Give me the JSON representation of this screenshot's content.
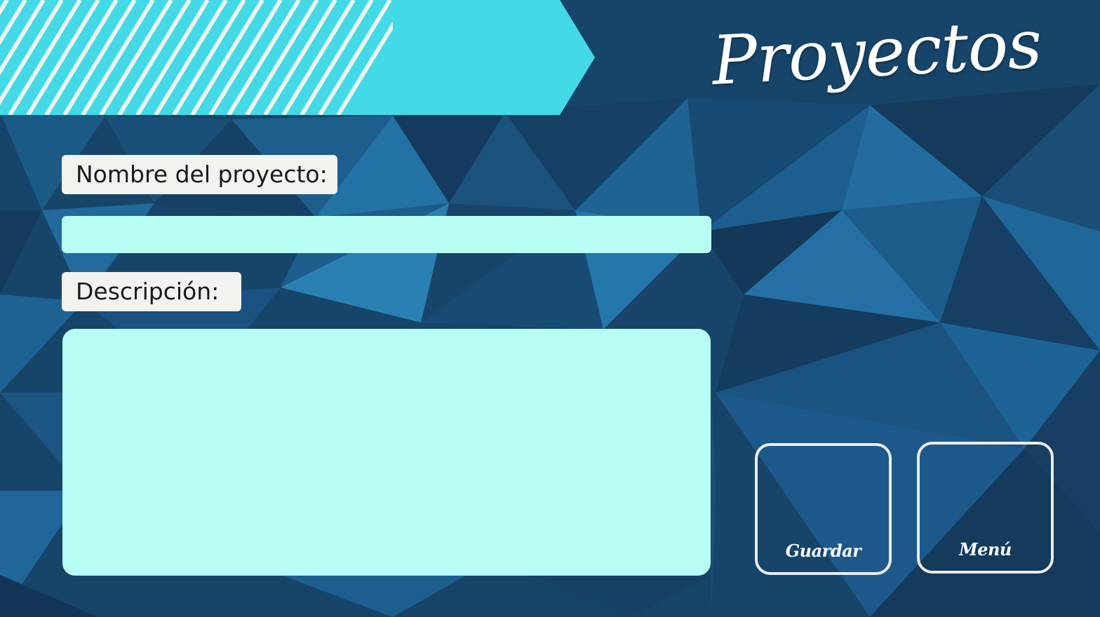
{
  "page": {
    "title": "Proyectos"
  },
  "form": {
    "name_label": "Nombre del proyecto:",
    "name_value": "",
    "description_label": "Descripción:",
    "description_value": ""
  },
  "actions": {
    "save_label": "Guardar",
    "menu_label": "Menú"
  },
  "colors": {
    "banner": "#43d9e6",
    "banner_stripes": "#eef4ee",
    "background_dark": "#12324f",
    "background_mid": "#1e5a86",
    "background_light": "#2a7fb3",
    "label_background": "#f2f2ee",
    "field_background": "#b8fdf3",
    "button_border": "#ececec",
    "title_text": "#ffffff"
  }
}
